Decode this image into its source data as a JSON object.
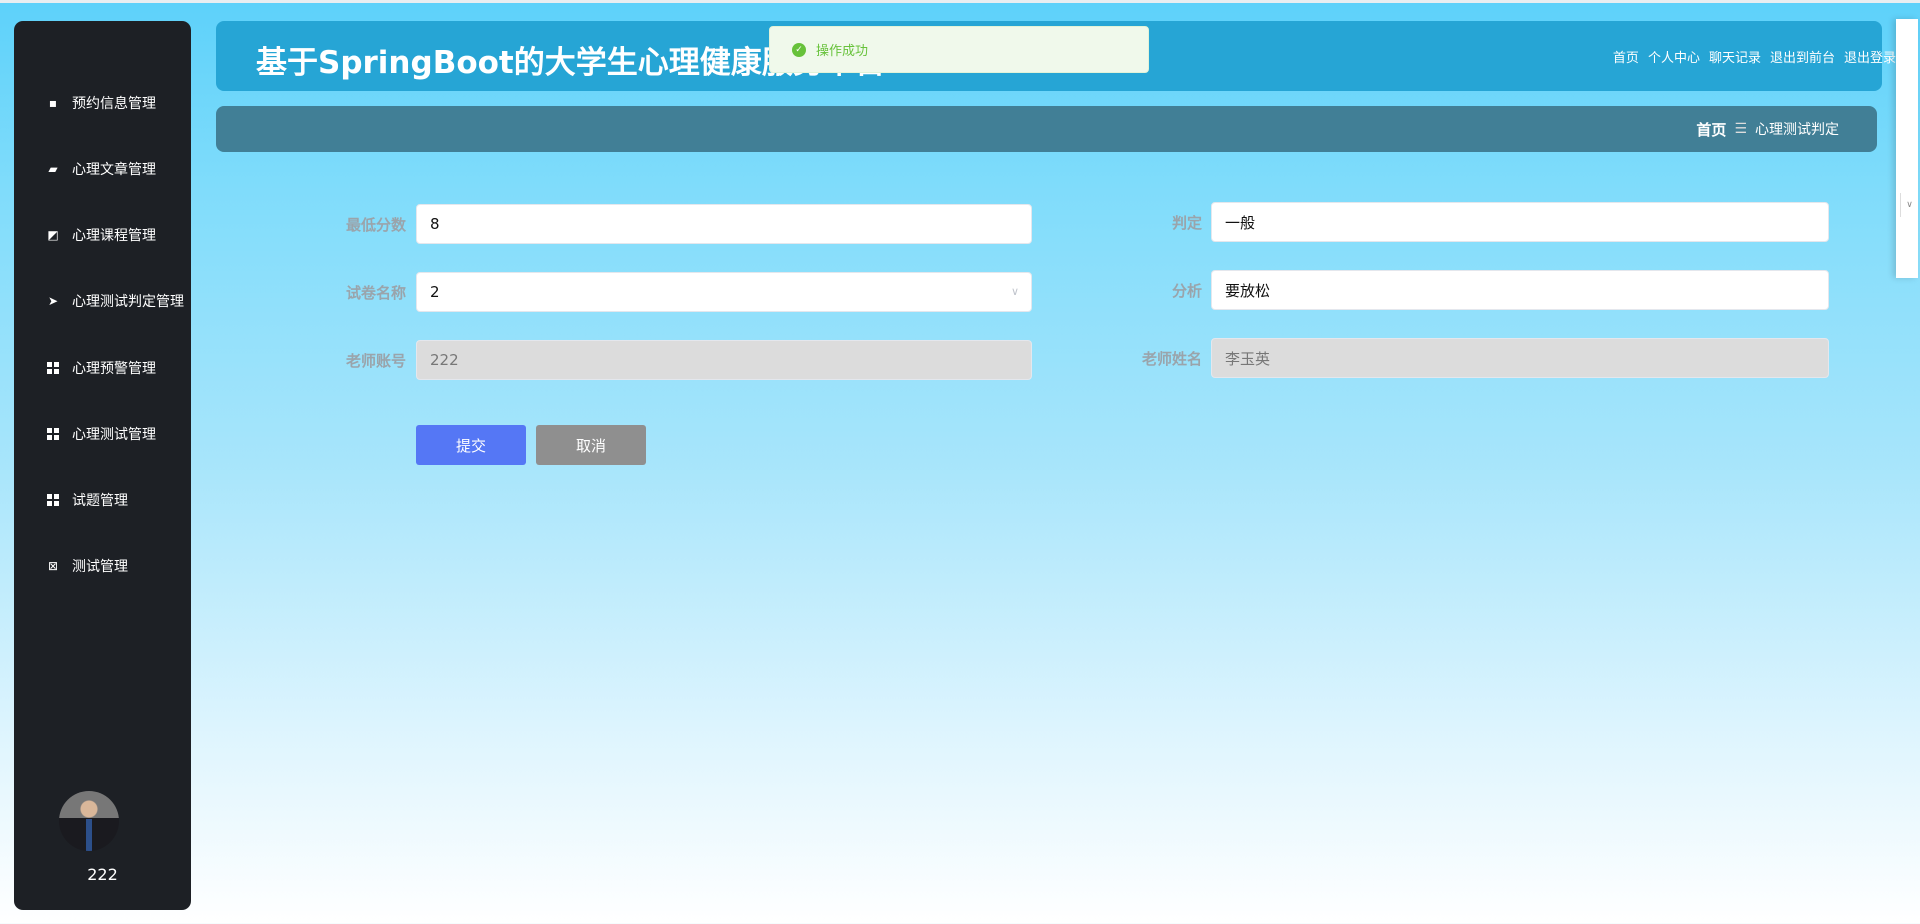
{
  "header": {
    "title": "基于SpringBoot的大学生心理健康服务平台",
    "nav": [
      "首页",
      "个人中心",
      "聊天记录",
      "退出到前台",
      "退出登录"
    ]
  },
  "toast": {
    "message": "操作成功",
    "icon": "check-circle-icon",
    "color": "#67c23a"
  },
  "breadcrumb": {
    "home": "首页",
    "separator": "☰",
    "current": "心理测试判定"
  },
  "sidebar": {
    "items": [
      {
        "label": "预约信息管理",
        "icon": "chat-icon"
      },
      {
        "label": "心理文章管理",
        "icon": "wallet-icon"
      },
      {
        "label": "心理课程管理",
        "icon": "chart-icon"
      },
      {
        "label": "心理测试判定管理",
        "icon": "paper-plane-icon"
      },
      {
        "label": "心理预警管理",
        "icon": "grid-icon"
      },
      {
        "label": "心理测试管理",
        "icon": "grid-icon"
      },
      {
        "label": "试题管理",
        "icon": "grid-icon"
      },
      {
        "label": "测试管理",
        "icon": "clipboard-icon"
      }
    ],
    "username": "222"
  },
  "form": {
    "min_score": {
      "label": "最低分数",
      "value": "8"
    },
    "paper_name": {
      "label": "试卷名称",
      "value": "2"
    },
    "teacher_account": {
      "label": "老师账号",
      "value": "222"
    },
    "judgement": {
      "label": "判定",
      "value": "一般"
    },
    "analysis": {
      "label": "分析",
      "value": "要放松"
    },
    "teacher_name": {
      "label": "老师姓名",
      "value": "李玉英"
    },
    "submit": "提交",
    "cancel": "取消"
  },
  "colors": {
    "sidebar": "#1d2025",
    "header": "#26a5d5",
    "breadcrumb": "#417f96",
    "submit": "#5577f5",
    "cancel": "#8f8f8f"
  }
}
